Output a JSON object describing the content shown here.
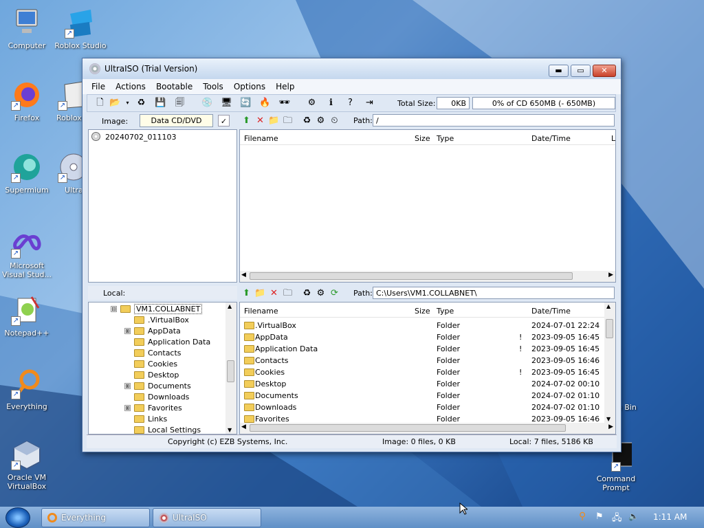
{
  "desktop": {
    "icons": [
      {
        "label": "Computer"
      },
      {
        "label": "Roblox Studio"
      },
      {
        "label": "Firefox"
      },
      {
        "label": "Roblox"
      },
      {
        "label": "Supermium"
      },
      {
        "label": "Ultra"
      },
      {
        "label": "Microsoft Visual Stud..."
      },
      {
        "label": "Notepad++"
      },
      {
        "label": "Everything"
      },
      {
        "label": "Oracle VM VirtualBox"
      },
      {
        "label": "e Bin"
      },
      {
        "label": "Command Prompt"
      }
    ]
  },
  "window": {
    "title": "UltraISO (Trial Version)",
    "controls": {
      "minimize": "▬",
      "maximize": "▭",
      "close": "✕"
    },
    "menu": [
      "File",
      "Actions",
      "Bootable",
      "Tools",
      "Options",
      "Help"
    ],
    "toolbar": {
      "total_size_label": "Total Size:",
      "total_size_value": "0KB",
      "capacity_text": "0% of CD 650MB (- 650MB)",
      "capacity_fraction": 0
    },
    "image_panel": {
      "label": "Image:",
      "type_value": "Data CD/DVD",
      "tree_root": "20240702_011103",
      "path_label": "Path:",
      "path_value": "/",
      "columns": [
        "Filename",
        "Size",
        "Type",
        "Date/Time",
        "L"
      ]
    },
    "local_panel": {
      "label": "Local:",
      "tree": [
        {
          "name": "VM1.COLLABNET",
          "expander": "⊟"
        },
        {
          "name": ".VirtualBox",
          "expander": ""
        },
        {
          "name": "AppData",
          "expander": "⊞"
        },
        {
          "name": "Application Data",
          "expander": ""
        },
        {
          "name": "Contacts",
          "expander": ""
        },
        {
          "name": "Cookies",
          "expander": ""
        },
        {
          "name": "Desktop",
          "expander": ""
        },
        {
          "name": "Documents",
          "expander": "⊞"
        },
        {
          "name": "Downloads",
          "expander": ""
        },
        {
          "name": "Favorites",
          "expander": "⊞"
        },
        {
          "name": "Links",
          "expander": ""
        },
        {
          "name": "Local Settings",
          "expander": ""
        }
      ],
      "path_label": "Path:",
      "path_value": "C:\\Users\\VM1.COLLABNET\\",
      "columns": [
        "Filename",
        "Size",
        "Type",
        "Date/Time"
      ],
      "files": [
        {
          "name": ".VirtualBox",
          "type": "Folder",
          "flag": "",
          "date": "2024-07-01 22:24"
        },
        {
          "name": "AppData",
          "type": "Folder",
          "flag": "!",
          "date": "2023-09-05 16:45"
        },
        {
          "name": "Application Data",
          "type": "Folder",
          "flag": "!",
          "date": "2023-09-05 16:45"
        },
        {
          "name": "Contacts",
          "type": "Folder",
          "flag": "",
          "date": "2023-09-05 16:46"
        },
        {
          "name": "Cookies",
          "type": "Folder",
          "flag": "!",
          "date": "2023-09-05 16:45"
        },
        {
          "name": "Desktop",
          "type": "Folder",
          "flag": "",
          "date": "2024-07-02 00:10"
        },
        {
          "name": "Documents",
          "type": "Folder",
          "flag": "",
          "date": "2024-07-02 01:10"
        },
        {
          "name": "Downloads",
          "type": "Folder",
          "flag": "",
          "date": "2024-07-02 01:10"
        },
        {
          "name": "Favorites",
          "type": "Folder",
          "flag": "",
          "date": "2023-09-05 16:46"
        }
      ]
    },
    "status": {
      "copyright": "Copyright (c) EZB Systems, Inc.",
      "image_info": "Image: 0 files, 0 KB",
      "local_info": "Local: 7 files, 5186 KB"
    }
  },
  "taskbar": {
    "tasks": [
      {
        "label": "Everything"
      },
      {
        "label": "UltraISO"
      }
    ],
    "clock": "1:11 AM"
  },
  "colors": {
    "accent": "#1d4e93",
    "progress_fill": "#8fb6e8"
  }
}
